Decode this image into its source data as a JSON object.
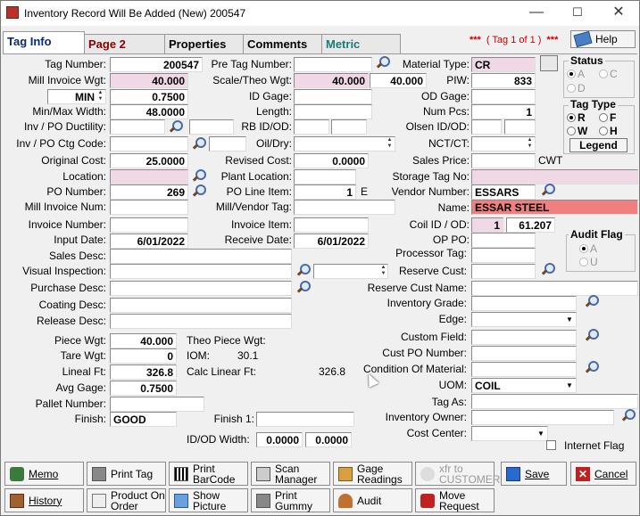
{
  "window": {
    "title": "Inventory Record Will Be Added  (New) 200547",
    "minimize": "—",
    "maximize": "☐",
    "close": "✕"
  },
  "tabs": [
    "Tag Info",
    "Page 2",
    "Properties",
    "Comments",
    "Metric"
  ],
  "tag_counter": {
    "stars_left": "***",
    "text": "( Tag 1 of 1 )",
    "stars_right": "***"
  },
  "help_label": "Help",
  "left": {
    "tag_number": {
      "label": "Tag Number:",
      "value": "200547"
    },
    "mill_invoice_wgt": {
      "label": "Mill Invoice Wgt:",
      "value": "40.000"
    },
    "min_select": "MIN",
    "min_value": "0.7500",
    "min_max_width": {
      "label": "Min/Max Width:",
      "value": "48.0000"
    },
    "inv_po_ductility": {
      "label": "Inv / PO Ductility:"
    },
    "inv_po_ctg_code": {
      "label": "Inv / PO Ctg Code:"
    },
    "original_cost": {
      "label": "Original Cost:",
      "value": "25.0000"
    },
    "location": {
      "label": "Location:"
    },
    "po_number": {
      "label": "PO Number:",
      "value": "269"
    },
    "mill_invoice_num": {
      "label": "Mill Invoice Num:"
    },
    "invoice_number": {
      "label": "Invoice Number:"
    },
    "input_date": {
      "label": "Input Date:",
      "value": "6/01/2022"
    },
    "sales_desc": {
      "label": "Sales Desc:"
    },
    "visual_inspection": {
      "label": "Visual Inspection:"
    },
    "purchase_desc": {
      "label": "Purchase Desc:"
    },
    "coating_desc": {
      "label": "Coating Desc:"
    },
    "release_desc": {
      "label": "Release Desc:"
    },
    "piece_wgt": {
      "label": "Piece Wgt:",
      "value": "40.000"
    },
    "tare_wgt": {
      "label": "Tare Wgt:",
      "value": "0"
    },
    "lineal_ft": {
      "label": "Lineal Ft:",
      "value": "326.8"
    },
    "avg_gage": {
      "label": "Avg Gage:",
      "value": "0.7500"
    },
    "pallet_number": {
      "label": "Pallet Number:"
    },
    "finish": {
      "label": "Finish:",
      "value": "GOOD"
    }
  },
  "mid": {
    "pre_tag_number": {
      "label": "Pre Tag Number:"
    },
    "scale_theo_wgt": {
      "label": "Scale/Theo Wgt:",
      "value1": "40.000",
      "value2": "40.000"
    },
    "id_gage": {
      "label": "ID Gage:"
    },
    "length": {
      "label": "Length:"
    },
    "rb_id_od": {
      "label": "RB ID/OD:"
    },
    "oil_dry": {
      "label": "Oil/Dry:"
    },
    "revised_cost": {
      "label": "Revised Cost:",
      "value": "0.0000"
    },
    "plant_location": {
      "label": "Plant Location:"
    },
    "po_line_item": {
      "label": "PO Line Item:",
      "value": "1",
      "suffix": "E"
    },
    "mill_vendor_tag": {
      "label": "Mill/Vendor Tag:"
    },
    "invoice_item": {
      "label": "Invoice Item:"
    },
    "receive_date": {
      "label": "Receive Date:",
      "value": "6/01/2022"
    },
    "theo_piece_wgt": {
      "label": "Theo Piece Wgt:"
    },
    "iom": {
      "label": "IOM:",
      "value": "30.1"
    },
    "calc_linear_ft": {
      "label": "Calc Linear Ft:",
      "value": "326.8"
    },
    "finish1": {
      "label": "Finish 1:"
    },
    "id_od_width": {
      "label": "ID/OD Width:",
      "value1": "0.0000",
      "value2": "0.0000"
    }
  },
  "right": {
    "material_type": {
      "label": "Material Type:",
      "value": "CR"
    },
    "piw": {
      "label": "PIW:",
      "value": "833"
    },
    "od_gage": {
      "label": "OD Gage:"
    },
    "num_pcs": {
      "label": "Num Pcs:",
      "value": "1"
    },
    "olsen_id_od": {
      "label": "Olsen ID/OD:"
    },
    "nct_ct": {
      "label": "NCT/CT:"
    },
    "sales_price": {
      "label": "Sales Price:",
      "unit": "CWT"
    },
    "storage_tag_no": {
      "label": "Storage Tag No:"
    },
    "vendor_number": {
      "label": "Vendor Number:",
      "value": "ESSARS"
    },
    "name": {
      "label": "Name:",
      "value": "ESSAR STEEL"
    },
    "coil_id_od": {
      "label": "Coil ID / OD:",
      "value1": "1",
      "value2": "61.207"
    },
    "op_po": {
      "label": "OP PO:"
    },
    "processor_tag": {
      "label": "Processor Tag:"
    },
    "reserve_cust": {
      "label": "Reserve Cust:"
    },
    "reserve_cust_name": {
      "label": "Reserve Cust Name:"
    },
    "inventory_grade": {
      "label": "Inventory Grade:"
    },
    "edge": {
      "label": "Edge:"
    },
    "custom_field": {
      "label": "Custom Field:"
    },
    "cust_po_number": {
      "label": "Cust PO Number:"
    },
    "condition_of_material": {
      "label": "Condition Of Material:"
    },
    "uom": {
      "label": "UOM:",
      "value": "COIL"
    },
    "tag_as": {
      "label": "Tag As:"
    },
    "inventory_owner": {
      "label": "Inventory Owner:"
    },
    "cost_center": {
      "label": "Cost Center:"
    },
    "internet_flag": {
      "label": "Internet Flag"
    }
  },
  "status_group": {
    "title": "Status",
    "options": [
      "A",
      "C",
      "D"
    ]
  },
  "tag_type_group": {
    "title": "Tag Type",
    "options": [
      "R",
      "F",
      "W",
      "H"
    ],
    "legend": "Legend"
  },
  "audit_group": {
    "title": "Audit Flag",
    "options": [
      "A",
      "U"
    ]
  },
  "buttons_row1": [
    "Memo",
    "Print Tag",
    "Print\nBarCode",
    "Scan\nManager",
    "Gage\nReadings",
    "xfr to\nCUSTOMER",
    "Save",
    "Cancel"
  ],
  "buttons_row2": [
    "History",
    "Product On\nOrder",
    "Show\nPicture",
    "Print\nGummy",
    "Audit",
    "Move\nRequest"
  ],
  "colors": {
    "pink_field": "#f0d8e6",
    "name_field": "#f08080",
    "tab_red": "#8b0000",
    "tab_teal": "#1a7a7a",
    "counter_red": "#cc0000"
  }
}
